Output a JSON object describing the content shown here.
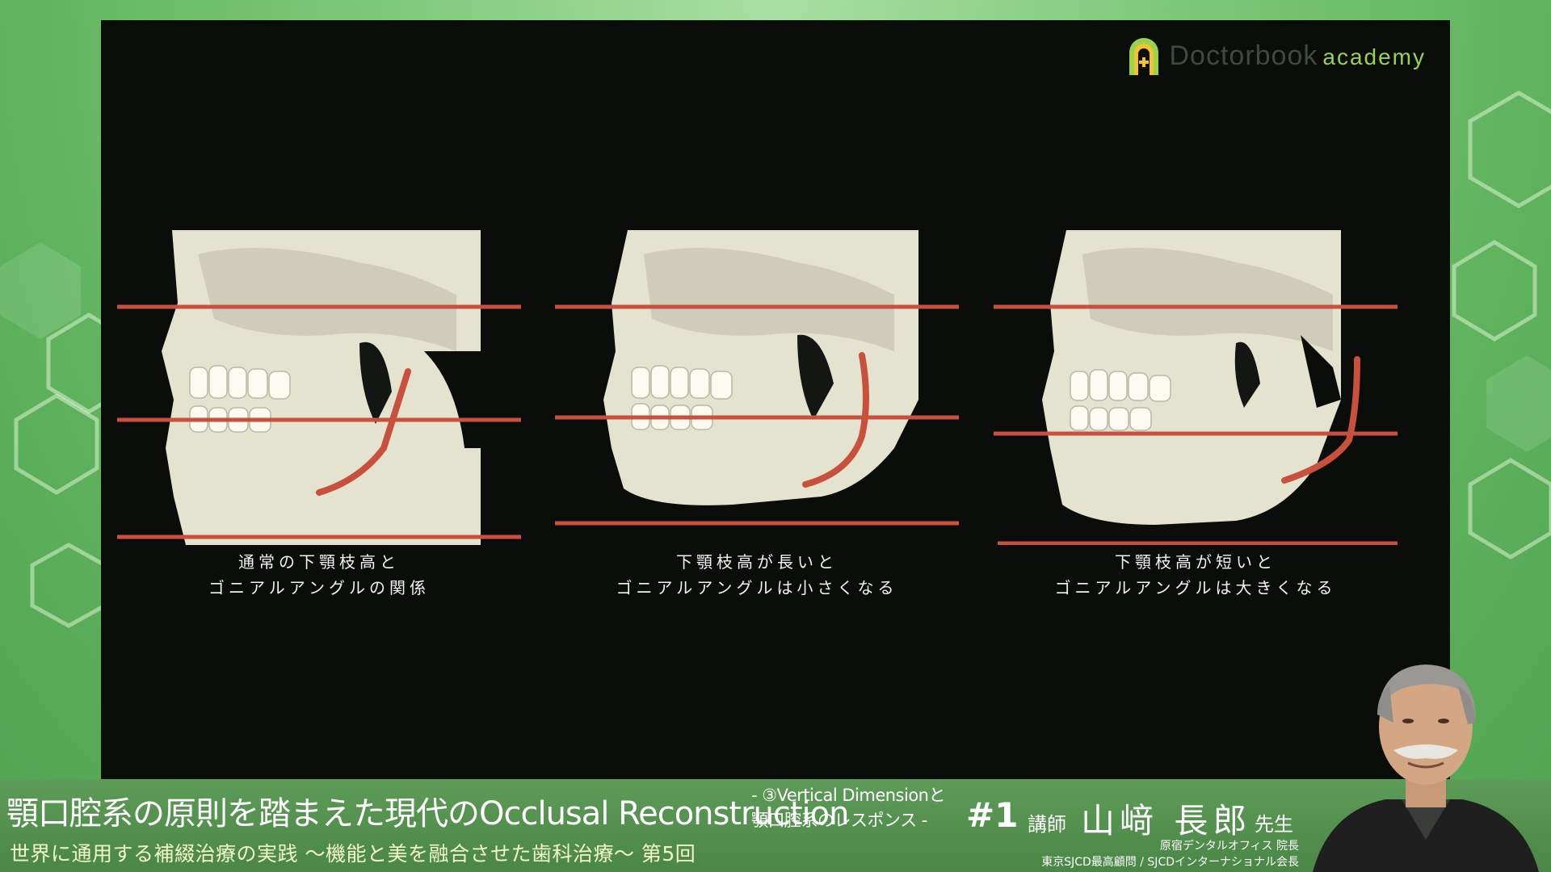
{
  "logo": {
    "brand": "Doctorbook",
    "suffix": "academy"
  },
  "panels": [
    {
      "caption_line1": "通常の下顎枝高と",
      "caption_line2": "ゴニアルアングルの関係"
    },
    {
      "caption_line1": "下顎枝高が長いと",
      "caption_line2": "ゴニアルアングルは小さくなる"
    },
    {
      "caption_line1": "下顎枝高が短いと",
      "caption_line2": "ゴニアルアングルは大きくなる"
    }
  ],
  "lower_third": {
    "title": "顎口腔系の原則を踏まえた現代のOcclusal Reconstruction",
    "subtitle_line1": "- ③Vertical Dimensionと",
    "subtitle_line2": "顎口腔系のレスポンス -",
    "series": "世界に通用する補綴治療の実践 〜機能と美を融合させた歯科治療〜 第5回",
    "episode": "#1",
    "lecturer_label": "講師",
    "lecturer_name": "山﨑 長郎",
    "lecturer_honorific": "先生",
    "affiliation_line1": "原宿デンタルオフィス 院長",
    "affiliation_line2": "東京SJCD最高顧問 / SJCDインターナショナル会長"
  },
  "colors": {
    "line_red": "#c8503c",
    "bone": "#e9e8d6",
    "brand_green": "#9ad34a"
  },
  "icons": {
    "logo": "doctorbook-arch-icon"
  }
}
